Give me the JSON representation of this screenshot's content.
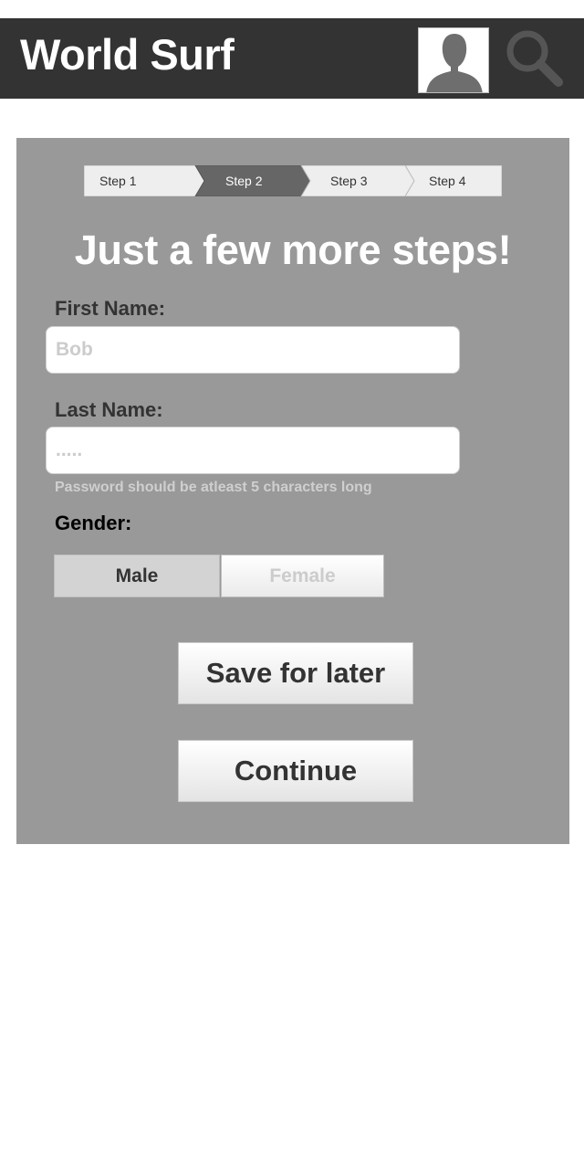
{
  "header": {
    "title": "World Surf",
    "avatar_icon": "user-avatar-icon",
    "search_icon": "magnifier-icon",
    "background": "#333333"
  },
  "stepper": {
    "steps": [
      "Step 1",
      "Step 2",
      "Step 3",
      "Step 4"
    ],
    "active_step": 2
  },
  "form": {
    "heading": "Just a few more steps!",
    "first_name": {
      "label": "First Name:",
      "placeholder": "Bob",
      "value": ""
    },
    "last_name": {
      "label": "Last Name:",
      "placeholder": ".....",
      "value": ""
    },
    "hint": "Password should be atleast 5 characters long",
    "gender": {
      "label": "Gender:",
      "options": [
        "Male",
        "Female"
      ],
      "selected": "Male"
    }
  },
  "actions": {
    "save_label": "Save for later",
    "continue_label": "Continue"
  },
  "colors": {
    "panel": "#999999",
    "active_step": "#666666",
    "inactive_step": "#eeeeee"
  }
}
